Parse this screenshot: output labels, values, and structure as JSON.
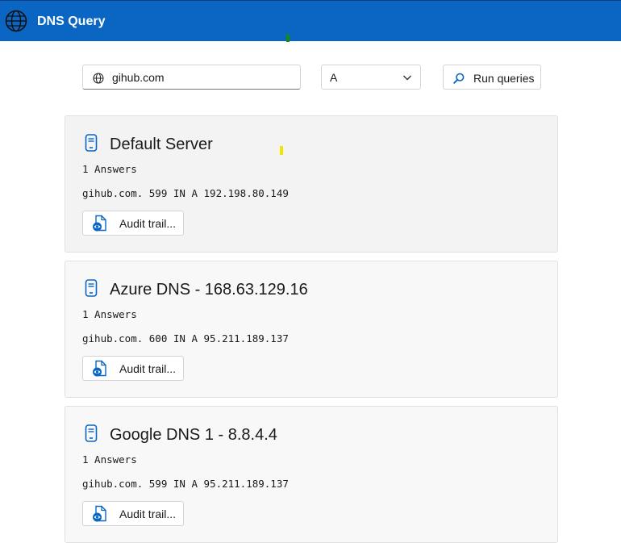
{
  "app": {
    "title": "DNS Query",
    "icon": "globe-icon",
    "accent_color": "#0a66c2"
  },
  "query": {
    "domain_value": "gihub.com",
    "domain_icon": "globe-icon",
    "record_type": "A",
    "run_label": "Run queries",
    "run_icon": "search-icon"
  },
  "results": [
    {
      "server": "Default Server",
      "answers": "1 Answers",
      "record": "gihub.com. 599 IN A 192.198.80.149",
      "audit_label": "Audit trail..."
    },
    {
      "server": "Azure DNS - 168.63.129.16",
      "answers": "1 Answers",
      "record": "gihub.com. 600 IN A 95.211.189.137",
      "audit_label": "Audit trail..."
    },
    {
      "server": "Google DNS 1 - 8.8.4.4",
      "answers": "1 Answers",
      "record": "gihub.com. 599 IN A 95.211.189.137",
      "audit_label": "Audit trail..."
    }
  ]
}
